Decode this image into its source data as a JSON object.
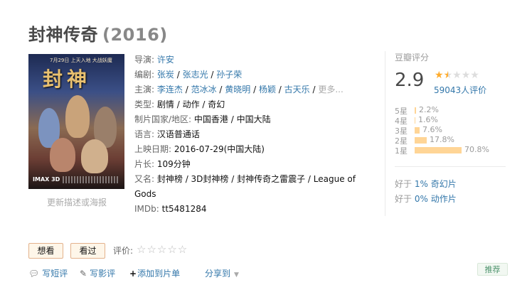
{
  "title": {
    "name": "封神传奇",
    "year": "(2016)"
  },
  "poster": {
    "title_art": "封神",
    "date_line": "7月29日 上天入地 大战妖魔",
    "badge": "IMAX 3D",
    "more_link": "更新描述或海报"
  },
  "info": {
    "director": {
      "label": "导演:",
      "names": [
        "许安"
      ]
    },
    "writers": {
      "label": "编剧:",
      "names": [
        "张炭",
        "张志光",
        "孙子荣"
      ]
    },
    "cast": {
      "label": "主演:",
      "names": [
        "李连杰",
        "范冰冰",
        "黄晓明",
        "杨颖",
        "古天乐"
      ],
      "more": "更多..."
    },
    "genre": {
      "label": "类型:",
      "names": [
        "剧情",
        "动作",
        "奇幻"
      ]
    },
    "region": {
      "label": "制片国家/地区:",
      "value": "中国香港 / 中国大陆"
    },
    "language": {
      "label": "语言:",
      "value": "汉语普通话"
    },
    "release": {
      "label": "上映日期:",
      "value": "2016-07-29(中国大陆)"
    },
    "runtime": {
      "label": "片长:",
      "value": "109分钟"
    },
    "aka": {
      "label": "又名:",
      "value": "封神榜 / 3D封神榜 / 封神传奇之雷震子 / League of Gods"
    },
    "imdb": {
      "label": "IMDb:",
      "value": "tt5481284"
    }
  },
  "rating": {
    "label": "豆瓣评分",
    "score": "2.9",
    "stars_value": 1.5,
    "votes": "59043人评价",
    "distribution": [
      {
        "label": "5星",
        "pct": "2.2%",
        "value": 2.2
      },
      {
        "label": "4星",
        "pct": "1.6%",
        "value": 1.6
      },
      {
        "label": "3星",
        "pct": "7.6%",
        "value": 7.6
      },
      {
        "label": "2星",
        "pct": "17.8%",
        "value": 17.8
      },
      {
        "label": "1星",
        "pct": "70.8%",
        "value": 70.8
      }
    ],
    "better_than": [
      {
        "prefix": "好于",
        "link": "1% 奇幻片"
      },
      {
        "prefix": "好于",
        "link": "0% 动作片"
      }
    ]
  },
  "actions": {
    "want": "想看",
    "seen": "看过",
    "rate_label": "评价:",
    "rate_stars": "☆☆☆☆☆"
  },
  "bottom": {
    "short_review": "写短评",
    "review": "写影评",
    "add_list": "添加到片单",
    "share": "分享到",
    "recommend": "推荐"
  },
  "colors": {
    "link": "#3377aa",
    "star": "#ffac2d",
    "bar": "#ffd596",
    "button_bg": "#fef6e9"
  }
}
